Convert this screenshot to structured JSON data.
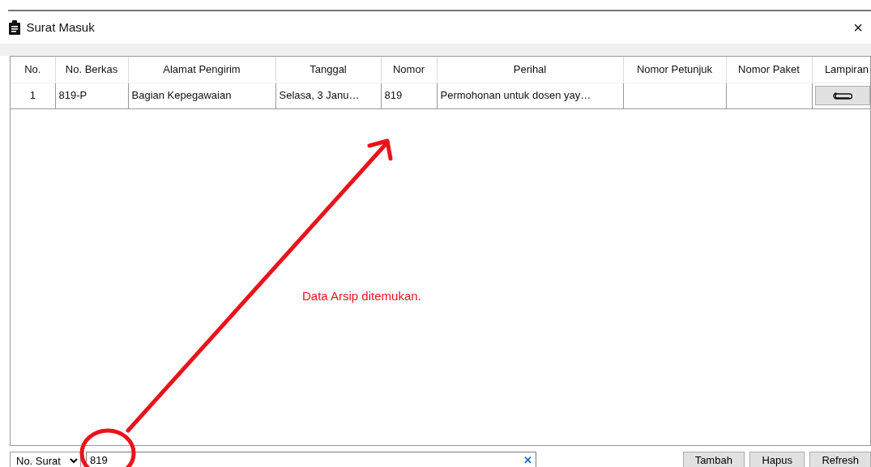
{
  "window": {
    "title": "Surat Masuk",
    "close": "×"
  },
  "table": {
    "columns": [
      "No.",
      "No. Berkas",
      "Alamat Pengirim",
      "Tanggal",
      "Nomor",
      "Perihal",
      "Nomor Petunjuk",
      "Nomor Paket",
      "Lampiran"
    ],
    "rows": [
      {
        "cells": [
          "1",
          "819-P",
          "Bagian Kepegawaian",
          "Selasa, 3 Janu…",
          "819",
          "Permohonan untuk dosen yay…",
          "",
          ""
        ],
        "attachment": true
      }
    ]
  },
  "message": "Data Arsip ditemukan.",
  "filter": {
    "value": "No. Surat"
  },
  "search": {
    "value": "819",
    "clear": "✕"
  },
  "buttons": [
    "Tambah",
    "Hapus",
    "Refresh"
  ]
}
